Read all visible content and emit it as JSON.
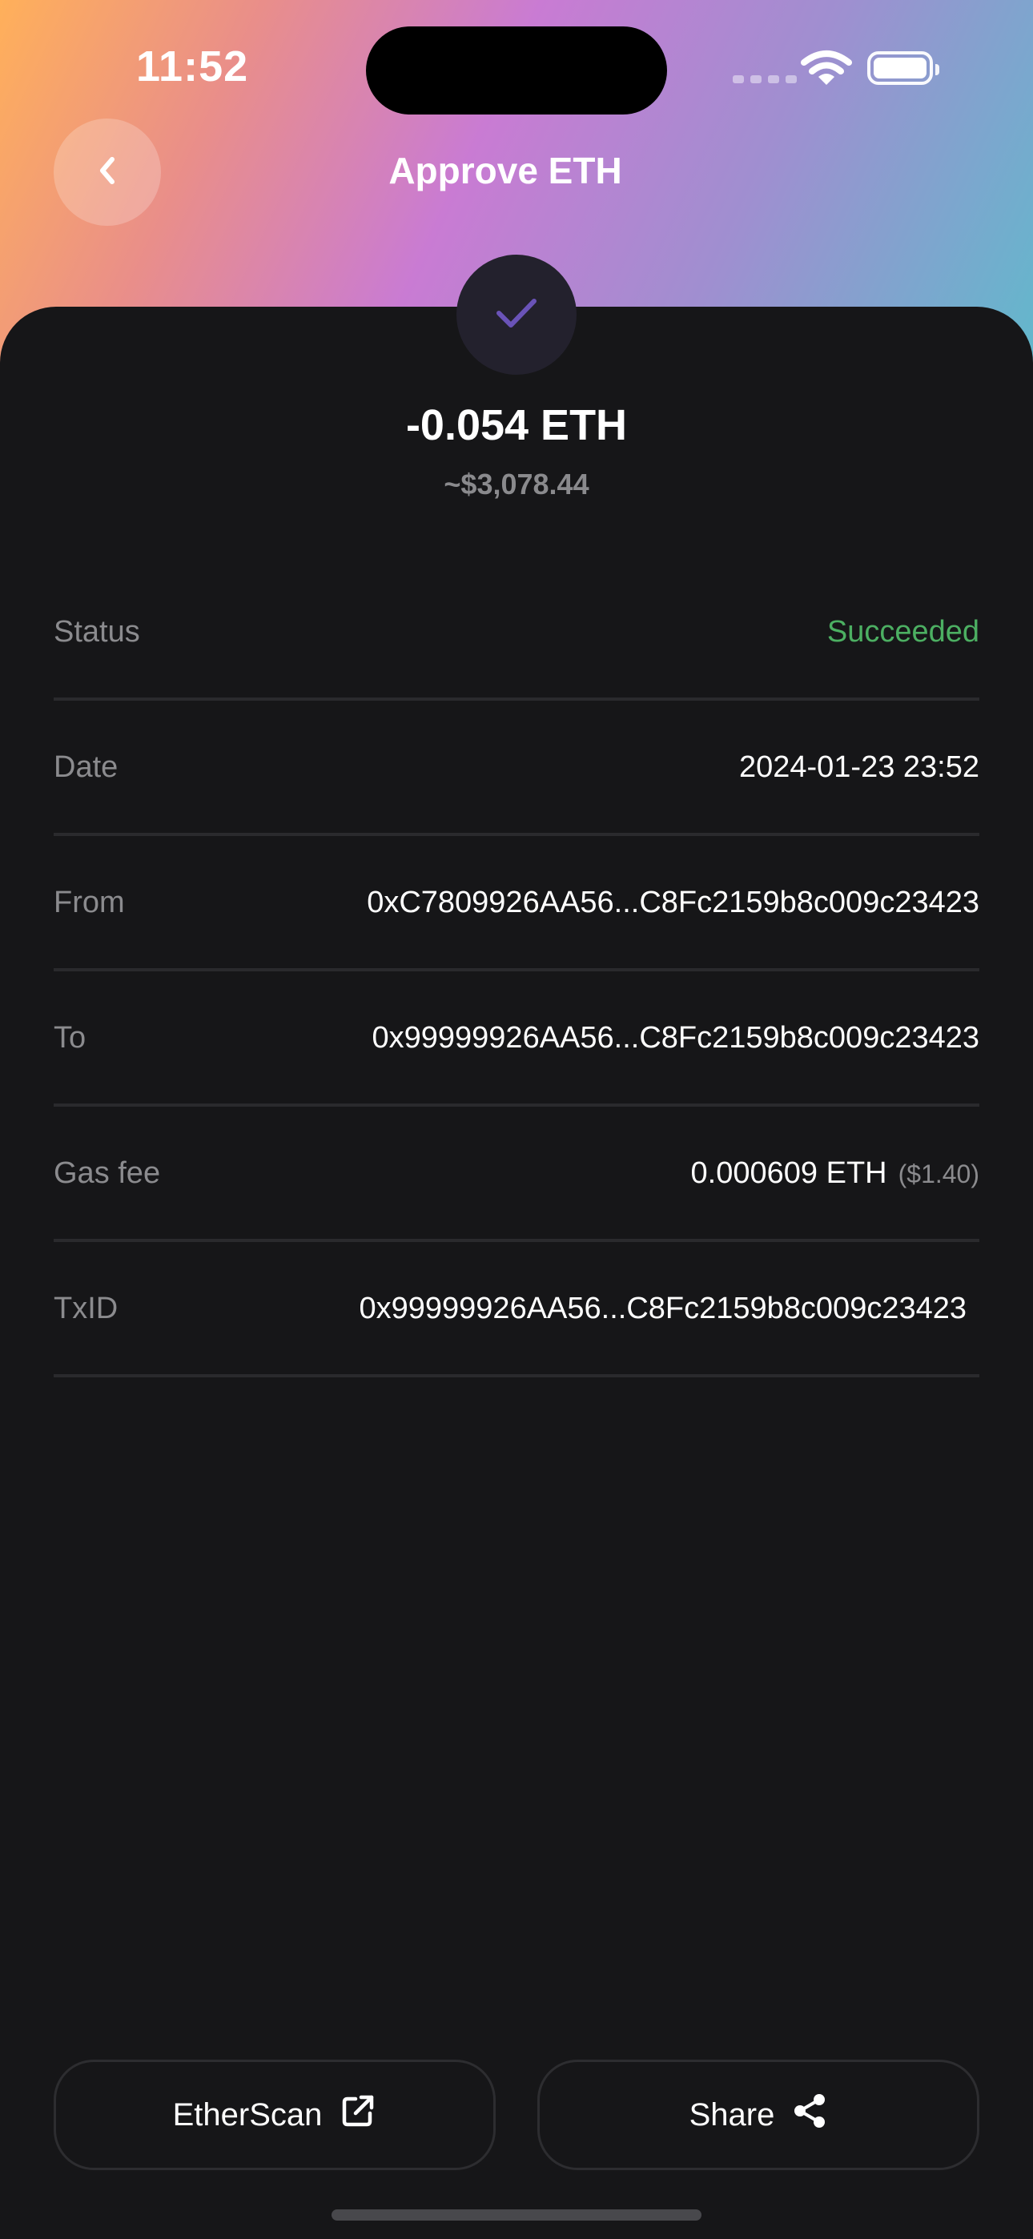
{
  "status_bar": {
    "time": "11:52"
  },
  "nav": {
    "title": "Approve ETH",
    "back_icon": "chevron-left-icon"
  },
  "summary": {
    "status_icon": "checkmark-icon",
    "amount": "-0.054 ETH",
    "fiat": "~$3,078.44"
  },
  "details": {
    "status_label": "Status",
    "status_value": "Succeeded",
    "date_label": "Date",
    "date_value": "2024-01-23 23:52",
    "from_label": "From",
    "from_value": "0xC7809926AA56...C8Fc2159b8c009c23423",
    "to_label": "To",
    "to_value": "0x99999926AA56...C8Fc2159b8c009c23423",
    "gas_label": "Gas fee",
    "gas_value": "0.000609 ETH",
    "gas_fiat": "($1.40)",
    "txid_label": "TxID",
    "txid_value": "0x99999926AA56...C8Fc2159b8c009c23423"
  },
  "actions": {
    "etherscan_label": "EtherScan",
    "etherscan_icon": "external-link-icon",
    "share_label": "Share",
    "share_icon": "share-icon"
  },
  "colors": {
    "success": "#4caf62",
    "background": "#161618",
    "accent_check": "#6a53b8"
  }
}
